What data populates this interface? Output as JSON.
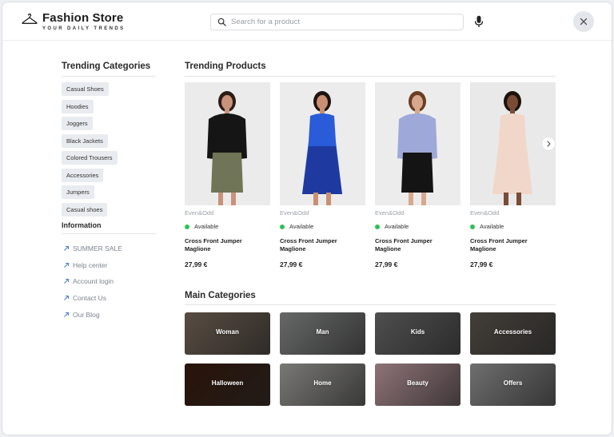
{
  "header": {
    "logo_name": "Fashion Store",
    "logo_tagline": "YOUR DAILY TRENDS",
    "search_placeholder": "Search for a product",
    "icons": [
      "hanger-icon",
      "search-icon",
      "microphone-icon",
      "close-icon"
    ]
  },
  "sidebar": {
    "trending_title": "Trending Categories",
    "trending": [
      "Casual Shoes",
      "Hoodies",
      "Joggers",
      "Black Jackets",
      "Colored Trousers",
      "Accessories",
      "Jumpers",
      "Casual shoes"
    ],
    "info_title": "Information",
    "info_links": [
      "SUMMER SALE",
      "Help center",
      "Account login",
      "Contact Us",
      "Our Blog"
    ]
  },
  "trending_products": {
    "title": "Trending Products",
    "items": [
      {
        "brand": "Even&Odd",
        "availability": "Available",
        "name": "Cross Front Jumper Maglione",
        "price": "27,99 €",
        "colors": {
          "top": "#151515",
          "bottom": "#6f7556",
          "bg": "#ebebeb",
          "skin": "#c9927a",
          "hair": "#2b1d16"
        }
      },
      {
        "brand": "Even&Odd",
        "availability": "Available",
        "name": "Cross Front Jumper Maglione",
        "price": "27,99 €",
        "colors": {
          "top": "#2a5bd8",
          "bottom": "#1e3aa0",
          "bg": "#ececec",
          "skin": "#c98f73",
          "hair": "#1d1410"
        }
      },
      {
        "brand": "Even&Odd",
        "availability": "Available",
        "name": "Cross Front Jumper Maglione",
        "price": "27,99 €",
        "colors": {
          "top": "#9ea9d9",
          "bottom": "#141414",
          "bg": "#ececec",
          "skin": "#d8a88e",
          "hair": "#6a3e25"
        }
      },
      {
        "brand": "Even&Odd",
        "availability": "Available",
        "name": "Cross Front Jumper Maglione",
        "price": "27,99 €",
        "colors": {
          "top": "#f1d7c9",
          "bottom": "#f1d7c9",
          "bg": "#e9e9e9",
          "skin": "#7a4c35",
          "hair": "#1b120d"
        }
      }
    ],
    "next_icon": "chevron-right-icon"
  },
  "main_categories": {
    "title": "Main Categories",
    "items": [
      {
        "label": "Woman",
        "color": "#7b6a5c"
      },
      {
        "label": "Man",
        "color": "#8f9090"
      },
      {
        "label": "Kids",
        "color": "#6d6d6d"
      },
      {
        "label": "Accessories",
        "color": "#5d574f"
      },
      {
        "label": "Halloween",
        "color": "#3a1b0c"
      },
      {
        "label": "Home",
        "color": "#a8a7a3"
      },
      {
        "label": "Beauty",
        "color": "#c6a0a6"
      },
      {
        "label": "Offers",
        "color": "#9a9a9a"
      }
    ]
  }
}
